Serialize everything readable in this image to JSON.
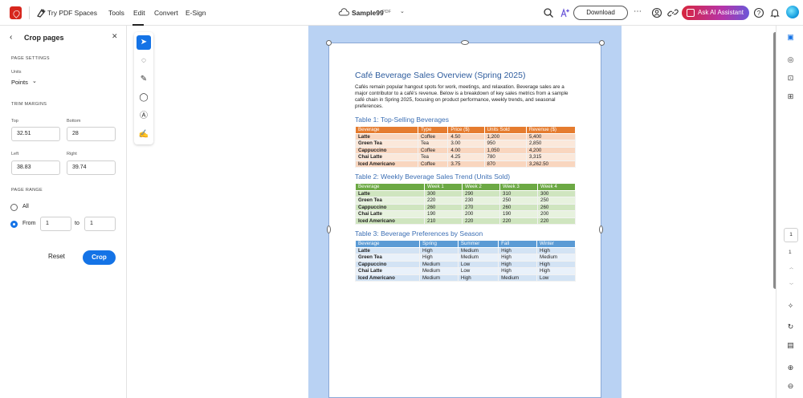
{
  "topbar": {
    "try_spaces": "Try PDF Spaces",
    "menu": [
      "Tools",
      "Edit",
      "Convert",
      "E-Sign"
    ],
    "file_name": "Sample99",
    "file_type": "PDF",
    "download": "Download",
    "ai_assistant": "Ask AI Assistant"
  },
  "panel": {
    "title": "Crop pages",
    "page_settings": "PAGE SETTINGS",
    "units_label": "Units",
    "units_value": "Points",
    "trim_margins": "TRIM MARGINS",
    "top_label": "Top",
    "top_value": "32.51",
    "bottom_label": "Bottom",
    "bottom_value": "28",
    "left_label": "Left",
    "left_value": "38.83",
    "right_label": "Right",
    "right_value": "39.74",
    "page_range": "PAGE RANGE",
    "all_label": "All",
    "from_label": "From",
    "from_value": "1",
    "to_label": "to",
    "to_value": "1",
    "reset": "Reset",
    "crop": "Crop"
  },
  "document": {
    "title": "Café Beverage Sales Overview (Spring 2025)",
    "intro": "Cafés remain popular hangout spots for work, meetings, and relaxation. Beverage sales are a major contributor to a café’s revenue. Below is a breakdown of key sales metrics from a sample café chain in Spring 2025, focusing on product performance, weekly trends, and seasonal preferences.",
    "table1": {
      "title": "Table 1: Top-Selling Beverages",
      "headers": [
        "Beverage",
        "Type",
        "Price ($)",
        "Units Sold",
        "Revenue ($)"
      ],
      "rows": [
        [
          "Latte",
          "Coffee",
          "4.50",
          "1,200",
          "5,400"
        ],
        [
          "Green Tea",
          "Tea",
          "3.00",
          "950",
          "2,850"
        ],
        [
          "Cappuccino",
          "Coffee",
          "4.00",
          "1,050",
          "4,200"
        ],
        [
          "Chai Latte",
          "Tea",
          "4.25",
          "780",
          "3,315"
        ],
        [
          "Iced Americano",
          "Coffee",
          "3.75",
          "870",
          "3,262.50"
        ]
      ]
    },
    "table2": {
      "title": "Table 2: Weekly Beverage Sales Trend (Units Sold)",
      "headers": [
        "Beverage",
        "Week 1",
        "Week 2",
        "Week 3",
        "Week 4"
      ],
      "rows": [
        [
          "Latte",
          "300",
          "290",
          "310",
          "300"
        ],
        [
          "Green Tea",
          "220",
          "230",
          "250",
          "250"
        ],
        [
          "Cappuccino",
          "260",
          "270",
          "260",
          "260"
        ],
        [
          "Chai Latte",
          "190",
          "200",
          "190",
          "200"
        ],
        [
          "Iced Americano",
          "210",
          "220",
          "220",
          "220"
        ]
      ]
    },
    "table3": {
      "title": "Table 3: Beverage Preferences by Season",
      "headers": [
        "Beverage",
        "Spring",
        "Summer",
        "Fall",
        "Winter"
      ],
      "rows": [
        [
          "Latte",
          "High",
          "Medium",
          "High",
          "High"
        ],
        [
          "Green Tea",
          "High",
          "Medium",
          "High",
          "Medium"
        ],
        [
          "Cappuccino",
          "Medium",
          "Low",
          "High",
          "High"
        ],
        [
          "Chai Latte",
          "Medium",
          "Low",
          "High",
          "High"
        ],
        [
          "Iced Americano",
          "Medium",
          "High",
          "Medium",
          "Low"
        ]
      ]
    }
  },
  "pager": {
    "current": "1",
    "total": "1"
  }
}
